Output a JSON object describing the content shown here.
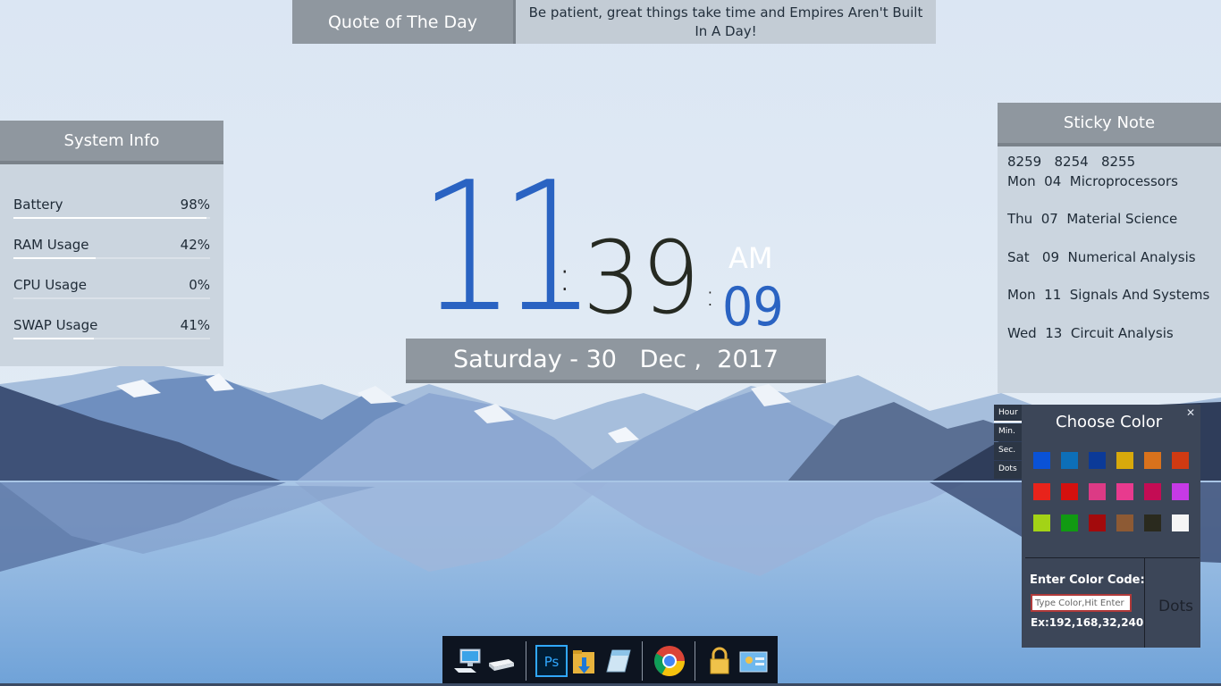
{
  "quote": {
    "title": "Quote of The Day",
    "text": "Be patient, great things take time and Empires Aren't Built In A Day!"
  },
  "system_info": {
    "title": "System Info",
    "rows": [
      {
        "label": "Battery",
        "value": "98%",
        "fraction": 0.98
      },
      {
        "label": "RAM Usage",
        "value": "42%",
        "fraction": 0.42
      },
      {
        "label": "CPU Usage",
        "value": "0%",
        "fraction": 0.0
      },
      {
        "label": "SWAP Usage",
        "value": "41%",
        "fraction": 0.41
      }
    ]
  },
  "clock": {
    "hour": "11",
    "minutes": "39",
    "seconds": "09",
    "ampm": "AM",
    "date": "Saturday - 30   Dec ,  2017"
  },
  "sticky_note": {
    "title": "Sticky Note",
    "lines": [
      "8259   8254   8255",
      "Mon  04  Microprocessors",
      "Thu  07  Material Science",
      "Sat   09  Numerical Analysis",
      "Mon  11  Signals And Systems",
      "Wed  13  Circuit Analysis"
    ]
  },
  "color_chooser": {
    "title": "Choose Color",
    "close": "✕",
    "tabs": [
      "Hour",
      "Min.",
      "Sec.",
      "Dots"
    ],
    "active_tab": "Hour",
    "swatches": [
      [
        "#0a52d6",
        "#0d6fb8",
        "#0b3a98",
        "#d8a90b",
        "#d9721c",
        "#d03a12"
      ],
      [
        "#e8231b",
        "#d5100e",
        "#dc3a85",
        "#e83a8e",
        "#c40c54",
        "#c63ae6"
      ],
      [
        "#a3d316",
        "#119a12",
        "#a30a0c",
        "#8d5a34",
        "#2a2a1e",
        "#f5f5f5"
      ]
    ],
    "code_label": "Enter Color Code:",
    "code_placeholder": "Type Color,Hit Enter",
    "code_example": "Ex:192,168,32,240",
    "target_label": "Dots"
  },
  "dock": {
    "icons": [
      "computer-icon",
      "drive-icon",
      "photoshop-icon",
      "downloads-folder-icon",
      "notepad-icon",
      "chrome-icon",
      "lock-icon",
      "control-panel-icon"
    ],
    "photoshop_text": "Ps"
  }
}
